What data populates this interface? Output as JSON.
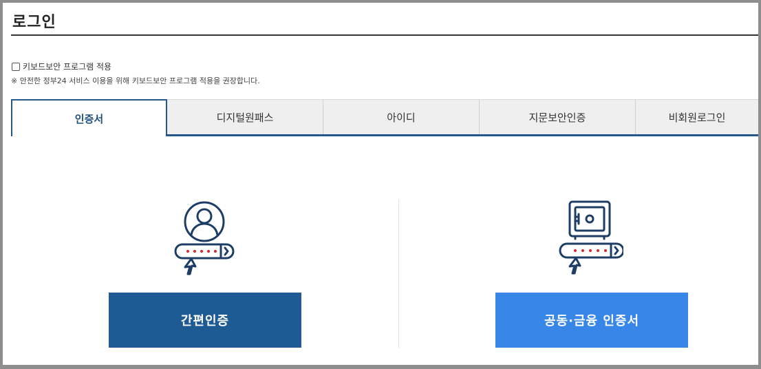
{
  "page": {
    "title": "로그인"
  },
  "keyboard_security": {
    "checkbox_label": "키보드보안 프로그램 적용",
    "checked": false,
    "note": "※ 안전한 정부24 서비스 이용을 위해 키보드보안 프로그램 적용을 권장합니다."
  },
  "tabs": [
    {
      "label": "인증서",
      "active": true
    },
    {
      "label": "디지털원패스",
      "active": false
    },
    {
      "label": "아이디",
      "active": false
    },
    {
      "label": "지문보안인증",
      "active": false
    },
    {
      "label": "비회원로그인",
      "active": false
    }
  ],
  "auth_options": {
    "simple": {
      "label": "간편인증",
      "icon": "user-password-icon",
      "color": "#1e5a93"
    },
    "joint": {
      "label": "공동·금융 인증서",
      "icon": "safe-password-icon",
      "color": "#3886e8"
    }
  },
  "colors": {
    "accent": "#24578b",
    "icon_stroke": "#1d3d66",
    "icon_dots": "#d9262c"
  }
}
